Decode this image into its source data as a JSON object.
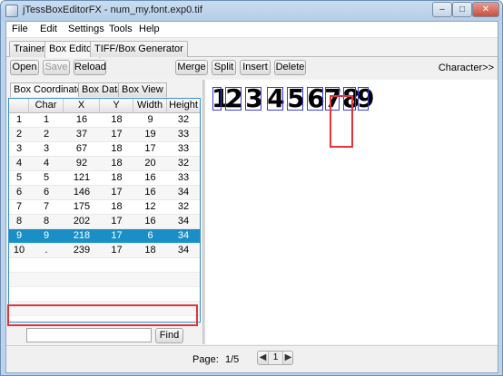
{
  "window": {
    "title": "jTessBoxEditorFX - num_my.font.exp0.tif",
    "minimize": "–",
    "maximize": "□",
    "close": "✕"
  },
  "menu": {
    "items": [
      {
        "label": "File"
      },
      {
        "label": "Edit"
      },
      {
        "label": "Settings"
      },
      {
        "label": "Tools"
      },
      {
        "label": "Help"
      }
    ]
  },
  "tabs": [
    {
      "label": "Trainer"
    },
    {
      "label": "Box Editor"
    },
    {
      "label": "TIFF/Box Generator"
    }
  ],
  "toolbar": {
    "open": "Open",
    "save": "Save",
    "reload": "Reload",
    "merge": "Merge",
    "split": "Split",
    "insert": "Insert",
    "delete": "Delete",
    "character": "Character>>"
  },
  "subtabs": [
    {
      "label": "Box Coordinates"
    },
    {
      "label": "Box Data"
    },
    {
      "label": "Box View"
    }
  ],
  "table": {
    "columns": [
      "",
      "Char",
      "X",
      "Y",
      "Width",
      "Height"
    ],
    "rows": [
      [
        "1",
        "1",
        "16",
        "18",
        "9",
        "32"
      ],
      [
        "2",
        "2",
        "37",
        "17",
        "19",
        "33"
      ],
      [
        "3",
        "3",
        "67",
        "18",
        "17",
        "33"
      ],
      [
        "4",
        "4",
        "92",
        "18",
        "20",
        "32"
      ],
      [
        "5",
        "5",
        "121",
        "18",
        "16",
        "33"
      ],
      [
        "6",
        "6",
        "146",
        "17",
        "16",
        "34"
      ],
      [
        "7",
        "7",
        "175",
        "18",
        "12",
        "32"
      ],
      [
        "8",
        "8",
        "202",
        "17",
        "16",
        "34"
      ],
      [
        "9",
        "9",
        "218",
        "17",
        "6",
        "34"
      ],
      [
        "10",
        ".",
        "239",
        "17",
        "18",
        "34"
      ]
    ],
    "selected_row": 8
  },
  "find": {
    "value": "",
    "button": "Find"
  },
  "canvas": {
    "glyphs": [
      "1",
      "2",
      "3",
      "4",
      "5",
      "6",
      "7",
      "8",
      "9"
    ]
  },
  "status": {
    "page_label": "Page:",
    "page_value": "1/5",
    "prev": "◀",
    "page_number": "1",
    "next": "▶"
  }
}
